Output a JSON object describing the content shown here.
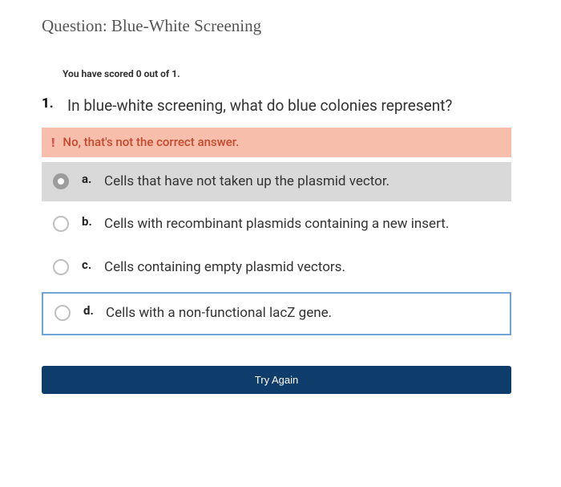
{
  "title": "Question: Blue-White Screening",
  "score_line": "You have scored 0 out of 1.",
  "question": {
    "number": "1.",
    "text": "In blue-white screening, what do blue colonies represent?"
  },
  "feedback": {
    "icon": "!",
    "text": "No, that's not the correct answer."
  },
  "options": [
    {
      "label": "a.",
      "text": "Cells that have not taken up the plasmid vector.",
      "selected": true,
      "correct": false
    },
    {
      "label": "b.",
      "text": "Cells with recombinant plasmids containing a new insert.",
      "selected": false,
      "correct": false
    },
    {
      "label": "c.",
      "text": "Cells containing empty plasmid vectors.",
      "selected": false,
      "correct": false
    },
    {
      "label": "d.",
      "text": "Cells with a non-functional lacZ gene.",
      "selected": false,
      "correct": true
    }
  ],
  "button": "Try Again"
}
